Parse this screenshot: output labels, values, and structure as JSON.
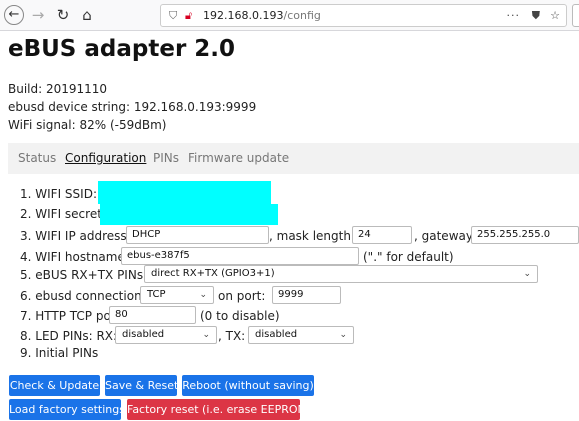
{
  "browser": {
    "url_host": "192.168.0.193",
    "url_path": "/config",
    "more_icon": "···"
  },
  "page": {
    "title": "eBUS adapter 2.0",
    "build": "Build: 20191110",
    "device_string": "ebusd device string: 192.168.0.193:9999",
    "wifi_signal": "WiFi signal: 82% (-59dBm)"
  },
  "tabs": [
    "Status",
    "Configuration",
    "PINs",
    "Firmware update"
  ],
  "form": {
    "ssid_label": "1. WIFI SSID:",
    "secret_label": "2. WIFI secret:",
    "ip_label": "3. WIFI IP address:",
    "ip_value": "DHCP",
    "mask_label": ", mask length:",
    "mask_value": "24",
    "gateway_label": ", gateway:",
    "gateway_value": "255.255.255.0",
    "hostname_label": "4. WIFI hostname:",
    "hostname_value": "ebus-e387f5",
    "hostname_hint": "(\".\" for default)",
    "ebus_pins_label": "5. eBUS RX+TX PINs:",
    "ebus_pins_value": "direct RX+TX (GPIO3+1)",
    "connection_label": "6. ebusd connection:",
    "connection_value": "TCP",
    "port_label": "on port:",
    "port_value": "9999",
    "http_label": "7. HTTP TCP port:",
    "http_value": "80",
    "http_hint": "(0 to disable)",
    "led_label": "8. LED PINs: RX:",
    "led_rx_value": "disabled",
    "led_tx_label": ", TX:",
    "led_tx_value": "disabled",
    "initial_label": "9. Initial PINs"
  },
  "buttons": {
    "check_update": "Check & Update",
    "save_reset": "Save & Reset",
    "reboot": "Reboot (without saving)",
    "load_factory": "Load factory settings",
    "factory_reset": "Factory reset (i.e. erase EEPROM)"
  },
  "colors": {
    "primary": "#1a73e8",
    "danger": "#dc3545",
    "redaction": "#00ffff"
  }
}
